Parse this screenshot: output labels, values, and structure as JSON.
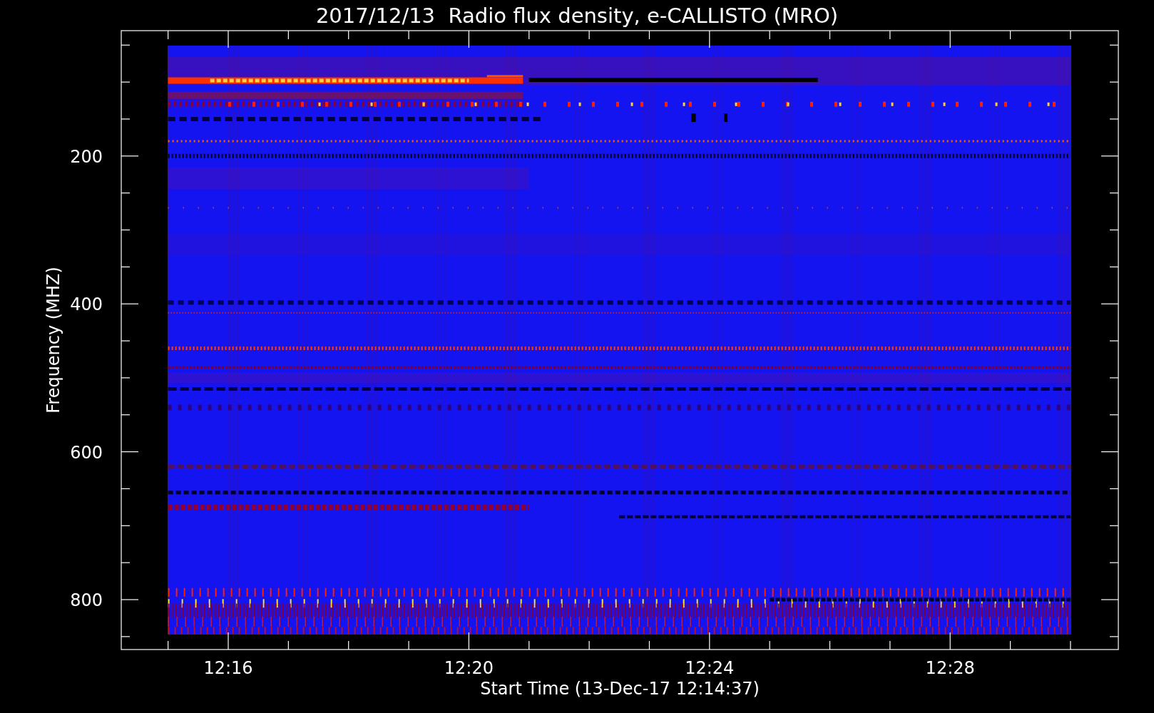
{
  "title": "2017/12/13  Radio flux density, e-CALLISTO (MRO)",
  "y_axis": {
    "label": "Frequency (MHZ)",
    "ticks": [
      "200",
      "400",
      "600",
      "800"
    ]
  },
  "x_axis": {
    "label": "Start Time (13-Dec-17 12:14:37)",
    "ticks": [
      "12:16",
      "12:20",
      "12:24",
      "12:28"
    ]
  }
}
